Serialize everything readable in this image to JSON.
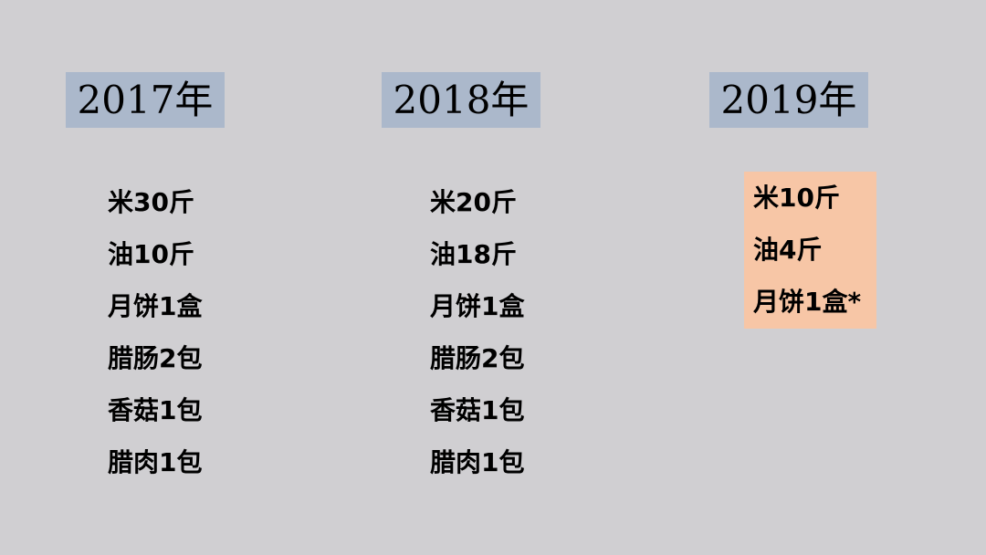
{
  "columns": [
    {
      "year": "2017年",
      "items": [
        "米30斤",
        "油10斤",
        "月饼1盒",
        "腊肠2包",
        "香菇1包",
        "腊肉1包"
      ]
    },
    {
      "year": "2018年",
      "items": [
        "米20斤",
        "油18斤",
        "月饼1盒",
        "腊肠2包",
        "香菇1包",
        "腊肉1包"
      ]
    },
    {
      "year": "2019年",
      "items": [
        "米10斤",
        "油4斤",
        "月饼1盒*"
      ]
    }
  ],
  "colors": {
    "background": "#d0cfd2",
    "year_label_bg": "#abb8cb",
    "highlight_bg": "#f7c6a6"
  }
}
